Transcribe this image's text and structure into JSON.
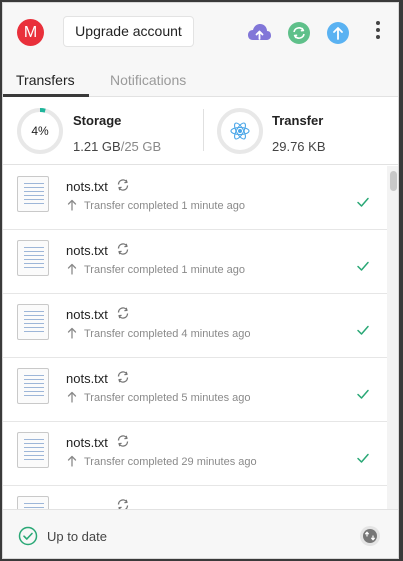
{
  "header": {
    "avatar_letter": "M",
    "upgrade_label": "Upgrade account",
    "icons": [
      "cloud-upload-icon",
      "sync-circle-icon",
      "upload-circle-icon",
      "more-vertical-icon"
    ]
  },
  "tabs": [
    {
      "label": "Transfers",
      "active": true
    },
    {
      "label": "Notifications",
      "active": false
    }
  ],
  "storage": {
    "title": "Storage",
    "percent_label": "4%",
    "percent": 4,
    "used": "1.21 GB",
    "total": "/25 GB"
  },
  "transfer": {
    "title": "Transfer",
    "amount": "29.76 KB"
  },
  "transfers": [
    {
      "filename": "nots.txt",
      "status": "Transfer completed 1 minute ago"
    },
    {
      "filename": "nots.txt",
      "status": "Transfer completed 1 minute ago"
    },
    {
      "filename": "nots.txt",
      "status": "Transfer completed 4 minutes ago"
    },
    {
      "filename": "nots.txt",
      "status": "Transfer completed 5 minutes ago"
    },
    {
      "filename": "nots.txt",
      "status": "Transfer completed 29 minutes ago"
    },
    {
      "filename": "",
      "status": ""
    }
  ],
  "footer": {
    "status_text": "Up to date"
  },
  "colors": {
    "accent_green": "#22a06b",
    "avatar_red": "#e9303b",
    "storage_ring": "#1fb59b",
    "upload_purple": "#7c6fd6",
    "upload_blue": "#3fa6f0"
  }
}
